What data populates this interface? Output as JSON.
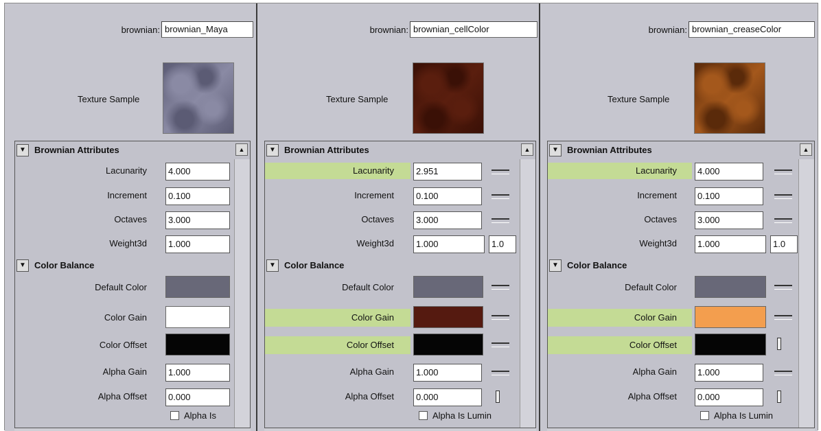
{
  "panels": [
    {
      "name_label": "brownian:",
      "name_value": "brownian_Maya",
      "texture_label": "Texture Sample",
      "texture_colors": [
        "#8a8aa4",
        "#5b5b74"
      ],
      "brownian_title": "Brownian Attributes",
      "lacunarity_label": "Lacunarity",
      "lacunarity": "4.000",
      "increment_label": "Increment",
      "increment": "0.100",
      "octaves_label": "Octaves",
      "octaves": "3.000",
      "weight_label": "Weight3d",
      "weight_x": "1.000",
      "weight_y": "",
      "color_title": "Color Balance",
      "default_color_label": "Default Color",
      "default_color": "#686878",
      "color_gain_label": "Color Gain",
      "color_gain": "#ffffff",
      "color_offset_label": "Color Offset",
      "color_offset": "#050505",
      "alpha_gain_label": "Alpha Gain",
      "alpha_gain": "1.000",
      "alpha_offset_label": "Alpha Offset",
      "alpha_offset": "0.000",
      "alpha_is_label": "Alpha Is"
    },
    {
      "name_label": "brownian:",
      "name_value": "brownian_cellColor",
      "texture_label": "Texture Sample",
      "texture_colors": [
        "#5a1e0e",
        "#3a1006"
      ],
      "brownian_title": "Brownian Attributes",
      "lacunarity_label": "Lacunarity",
      "lacunarity": "2.951",
      "increment_label": "Increment",
      "increment": "0.100",
      "octaves_label": "Octaves",
      "octaves": "3.000",
      "weight_label": "Weight3d",
      "weight_x": "1.000",
      "weight_y": "1.0",
      "color_title": "Color Balance",
      "default_color_label": "Default Color",
      "default_color": "#686878",
      "color_gain_label": "Color Gain",
      "color_gain": "#551a10",
      "color_offset_label": "Color Offset",
      "color_offset": "#050505",
      "alpha_gain_label": "Alpha Gain",
      "alpha_gain": "1.000",
      "alpha_offset_label": "Alpha Offset",
      "alpha_offset": "0.000",
      "alpha_is_label": "Alpha Is Lumin"
    },
    {
      "name_label": "brownian:",
      "name_value": "brownian_creaseColor",
      "texture_label": "Texture Sample",
      "texture_colors": [
        "#a4581c",
        "#5a2a0a"
      ],
      "brownian_title": "Brownian Attributes",
      "lacunarity_label": "Lacunarity",
      "lacunarity": "4.000",
      "increment_label": "Increment",
      "increment": "0.100",
      "octaves_label": "Octaves",
      "octaves": "3.000",
      "weight_label": "Weight3d",
      "weight_x": "1.000",
      "weight_y": "1.0",
      "color_title": "Color Balance",
      "default_color_label": "Default Color",
      "default_color": "#686878",
      "color_gain_label": "Color Gain",
      "color_gain": "#f39e4e",
      "color_offset_label": "Color Offset",
      "color_offset": "#050505",
      "alpha_gain_label": "Alpha Gain",
      "alpha_gain": "1.000",
      "alpha_offset_label": "Alpha Offset",
      "alpha_offset": "0.000",
      "alpha_is_label": "Alpha Is Lumin"
    }
  ],
  "colors": {
    "highlight": "#c4db95",
    "panel_bg": "#c6c6cf"
  }
}
